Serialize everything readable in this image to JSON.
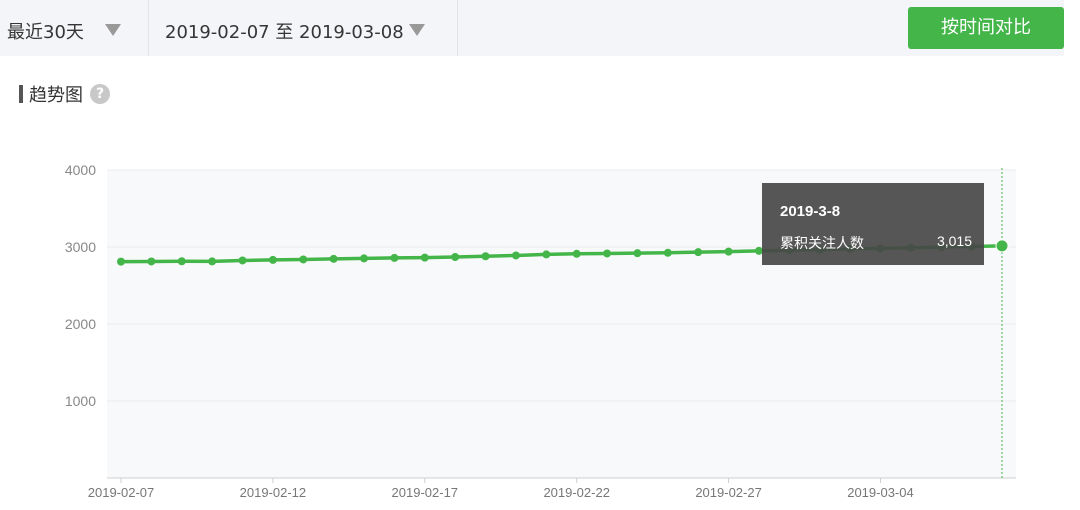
{
  "filters": {
    "period_label": "最近30天",
    "date_range": "2019-02-07 至 2019-03-08",
    "compare_button": "按时间对比"
  },
  "section": {
    "title": "趋势图",
    "help_glyph": "?"
  },
  "tooltip": {
    "date": "2019-3-8",
    "series_name": "累积关注人数",
    "value": "3,015"
  },
  "colors": {
    "accent": "#44b549",
    "line": "#44b549",
    "plot_bg": "#f8f9fb",
    "tooltip_bg": "#484848"
  },
  "chart_data": {
    "type": "line",
    "x": [
      "2019-02-07",
      "2019-02-08",
      "2019-02-09",
      "2019-02-10",
      "2019-02-11",
      "2019-02-12",
      "2019-02-13",
      "2019-02-14",
      "2019-02-15",
      "2019-02-16",
      "2019-02-17",
      "2019-02-18",
      "2019-02-19",
      "2019-02-20",
      "2019-02-21",
      "2019-02-22",
      "2019-02-23",
      "2019-02-24",
      "2019-02-25",
      "2019-02-26",
      "2019-02-27",
      "2019-02-28",
      "2019-03-01",
      "2019-03-02",
      "2019-03-03",
      "2019-03-04",
      "2019-03-05",
      "2019-03-06",
      "2019-03-07",
      "2019-03-08"
    ],
    "x_tick_labels": [
      "2019-02-07",
      "2019-02-12",
      "2019-02-17",
      "2019-02-22",
      "2019-02-27",
      "2019-03-04"
    ],
    "series": [
      {
        "name": "累积关注人数",
        "values": [
          2810,
          2812,
          2815,
          2813,
          2825,
          2832,
          2838,
          2846,
          2852,
          2858,
          2862,
          2870,
          2880,
          2890,
          2904,
          2912,
          2916,
          2920,
          2925,
          2933,
          2940,
          2950,
          2958,
          2966,
          2975,
          2982,
          2990,
          2998,
          3006,
          3015
        ]
      }
    ],
    "ylim": [
      0,
      4000
    ],
    "y_ticks": [
      1000,
      2000,
      3000,
      4000
    ],
    "grid": true,
    "highlighted_x": "2019-03-08"
  }
}
